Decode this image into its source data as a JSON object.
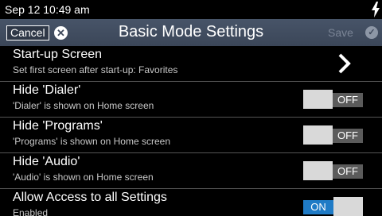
{
  "status_bar": {
    "time": "Sep 12 10:49 am"
  },
  "header": {
    "title": "Basic Mode Settings",
    "cancel_label": "Cancel",
    "save_label": "Save"
  },
  "settings": [
    {
      "title": "Start-up Screen",
      "subtitle": "Set first screen after start-up: Favorites",
      "control": "chevron"
    },
    {
      "title": "Hide 'Dialer'",
      "subtitle": "'Dialer' is shown on Home screen",
      "control": "toggle",
      "state": "OFF"
    },
    {
      "title": "Hide 'Programs'",
      "subtitle": "'Programs' is shown on Home screen",
      "control": "toggle",
      "state": "OFF"
    },
    {
      "title": "Hide 'Audio'",
      "subtitle": "'Audio' is shown on Home screen",
      "control": "toggle",
      "state": "OFF"
    },
    {
      "title": "Allow Access to all Settings",
      "subtitle": "Enabled",
      "control": "toggle",
      "state": "ON"
    }
  ]
}
